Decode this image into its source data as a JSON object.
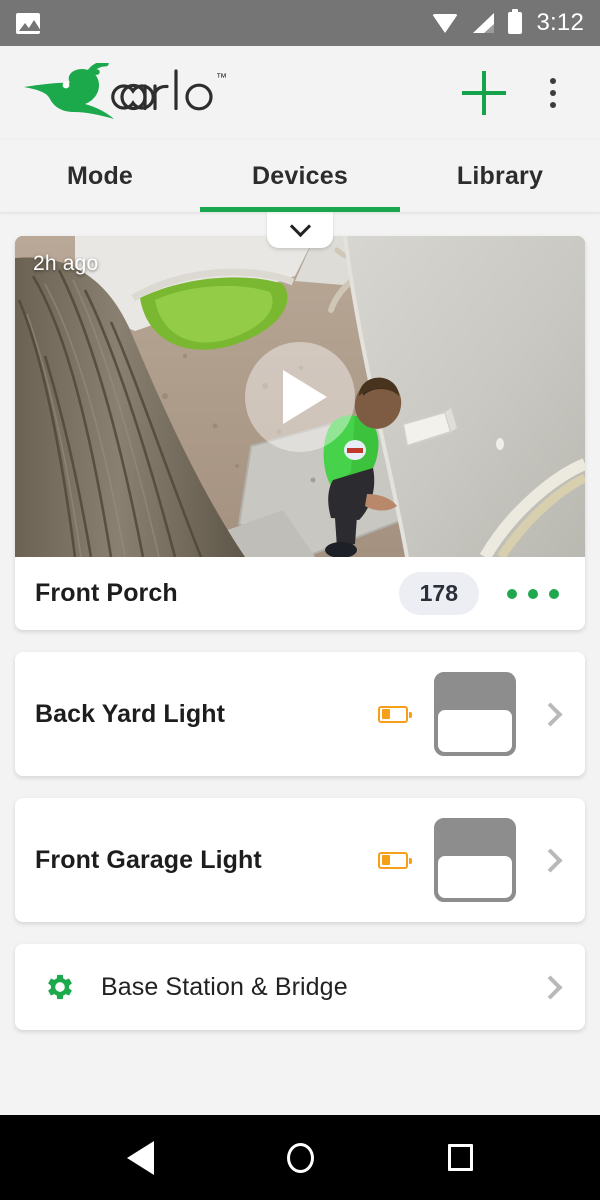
{
  "status_bar": {
    "left_icon": "image-icon",
    "icons": [
      "wifi-icon",
      "cellular-signal-icon",
      "battery-icon"
    ],
    "time": "3:12",
    "background_color": "#757575"
  },
  "app_bar": {
    "brand_name": "arlo",
    "trademark": "™",
    "brand_color": "#19a34b",
    "add_label": "+",
    "add_icon": "plus-icon",
    "overflow_icon": "more-vertical-icon"
  },
  "tabs": {
    "items": [
      {
        "label": "Mode",
        "active": false
      },
      {
        "label": "Devices",
        "active": true
      },
      {
        "label": "Library",
        "active": false
      }
    ],
    "active_color": "#19a64d",
    "pull_handle_icon": "chevron-down-icon"
  },
  "devices": {
    "camera": {
      "name": "Front Porch",
      "timestamp": "2h ago",
      "recording_count": "178",
      "play_icon": "play-icon",
      "more_icon": "more-horizontal-icon",
      "badge_color": "#eceef4",
      "dots_color": "#21a84e"
    },
    "lights": [
      {
        "name": "Back Yard Light",
        "battery_icon": "low-battery-icon",
        "battery_color": "#f6a01a",
        "toggle_state": "off",
        "chevron_icon": "chevron-right-icon"
      },
      {
        "name": "Front Garage Light",
        "battery_icon": "low-battery-icon",
        "battery_color": "#f6a01a",
        "toggle_state": "off",
        "chevron_icon": "chevron-right-icon"
      }
    ],
    "base_station": {
      "label": "Base Station & Bridge",
      "icon": "gear-icon",
      "icon_color": "#1ba94c",
      "chevron_icon": "chevron-right-icon"
    }
  },
  "nav_bar": {
    "back": "back-icon",
    "home": "home-icon",
    "recents": "recents-icon",
    "background_color": "#000000"
  }
}
